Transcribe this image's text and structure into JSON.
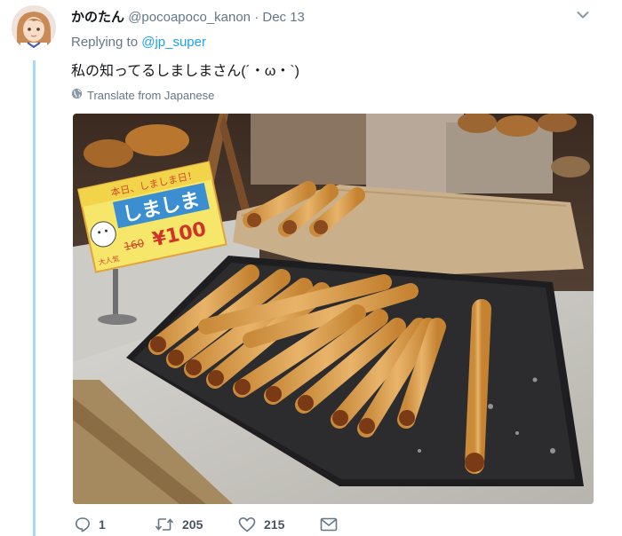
{
  "tweet": {
    "display_name": "かのたん",
    "handle": "@pocoapoco_kanon",
    "separator": "·",
    "date": "Dec 13",
    "replying_prefix": "Replying to",
    "replying_to": "@jp_super",
    "text": "私の知ってるしましまさん(´・ω・`)",
    "translate_label": "Translate from Japanese"
  },
  "photo_sign": {
    "top_text": "本日、しましま日！",
    "main_text": "しましま",
    "price_old": "160",
    "price_new": "¥100",
    "badge": "大人気"
  },
  "actions": {
    "reply_count": "1",
    "retweet_count": "205",
    "like_count": "215"
  },
  "icons": [
    "caret-down-icon",
    "globe-icon",
    "reply-icon",
    "retweet-icon",
    "heart-icon",
    "message-icon"
  ],
  "colors": {
    "accent": "#1da1f2",
    "thread_line": "#a4d9f9",
    "muted": "#657786"
  }
}
